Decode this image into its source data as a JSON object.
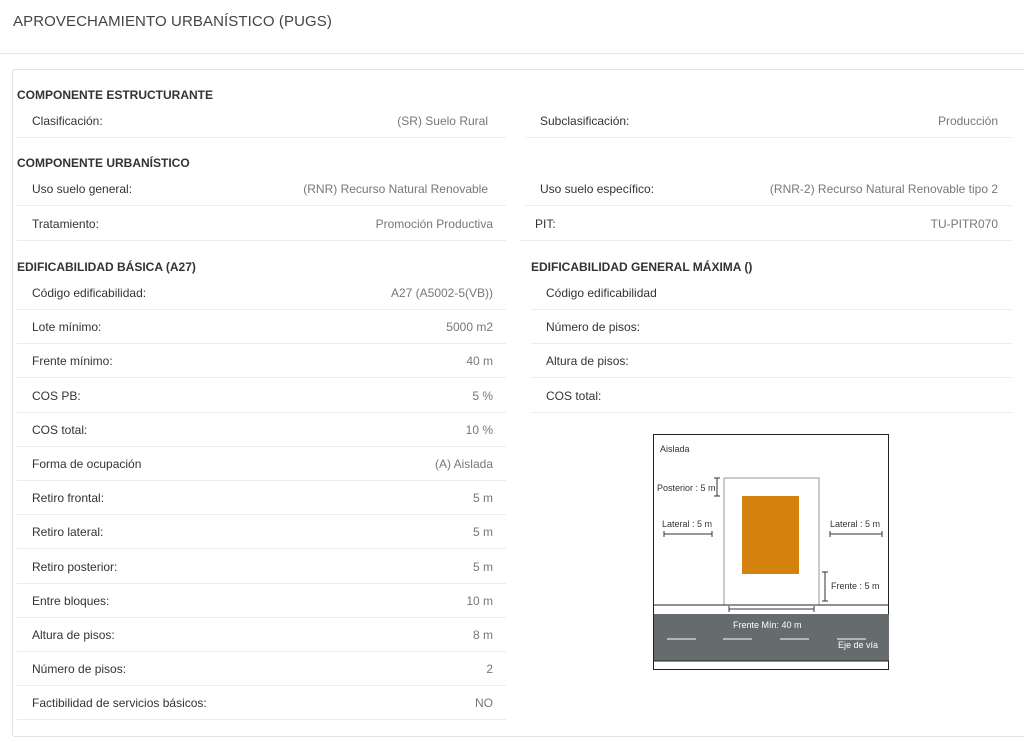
{
  "header": {
    "title": "APROVECHAMIENTO URBANÍSTICO (PUGS)"
  },
  "estructurante": {
    "title": "COMPONENTE ESTRUCTURANTE",
    "clasificacion": {
      "label": "Clasificación:",
      "value": "(SR) Suelo Rural"
    },
    "subclasificacion": {
      "label": "Subclasificación:",
      "value": "Producción"
    }
  },
  "urbanistico": {
    "title": "COMPONENTE URBANÍSTICO",
    "uso_general": {
      "label": "Uso suelo general:",
      "value": "(RNR) Recurso Natural Renovable"
    },
    "uso_especifico": {
      "label": "Uso suelo específico:",
      "value": "(RNR-2) Recurso Natural Renovable tipo 2"
    },
    "tratamiento": {
      "label": "Tratamiento:",
      "value": "Promoción Productiva"
    },
    "pit": {
      "label": "PIT:",
      "value": "TU-PITR070"
    }
  },
  "basica": {
    "title": "EDIFICABILIDAD BÁSICA (A27)",
    "rows": [
      {
        "label": "Código edificabilidad:",
        "value": "A27 (A5002-5(VB))"
      },
      {
        "label": "Lote mínimo:",
        "value": "5000 m2"
      },
      {
        "label": "Frente mínimo:",
        "value": "40 m"
      },
      {
        "label": "COS PB:",
        "value": "5 %"
      },
      {
        "label": "COS total:",
        "value": "10 %"
      },
      {
        "label": "Forma de ocupación",
        "value": "(A) Aislada"
      },
      {
        "label": "Retiro frontal:",
        "value": "5 m"
      },
      {
        "label": "Retiro lateral:",
        "value": "5 m"
      },
      {
        "label": "Retiro posterior:",
        "value": "5 m"
      },
      {
        "label": "Entre bloques:",
        "value": "10 m"
      },
      {
        "label": "Altura de pisos:",
        "value": "8 m"
      },
      {
        "label": "Número de pisos:",
        "value": "2"
      },
      {
        "label": "Factibilidad de servicios básicos:",
        "value": "NO"
      }
    ]
  },
  "maxima": {
    "title": "EDIFICABILIDAD GENERAL MÁXIMA ()",
    "rows": [
      {
        "label": "Código edificabilidad",
        "value": ""
      },
      {
        "label": "Número de pisos:",
        "value": ""
      },
      {
        "label": "Altura de pisos:",
        "value": ""
      },
      {
        "label": "COS total:",
        "value": ""
      }
    ]
  },
  "diagram": {
    "type_label": "Aislada",
    "posterior": "Posterior : 5 m",
    "lateral_left": "Lateral : 5 m",
    "lateral_right": "Lateral : 5 m",
    "frente": "Frente : 5 m",
    "frente_min": "Frente Mín: 40 m",
    "eje": "Eje de vía",
    "colors": {
      "building": "#d4820f",
      "road": "#666b6d"
    }
  }
}
